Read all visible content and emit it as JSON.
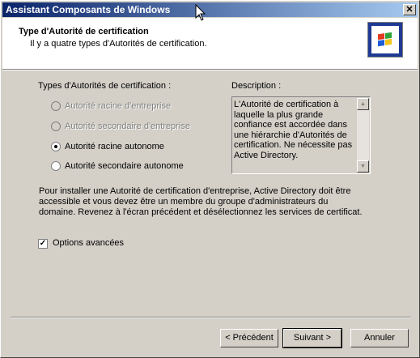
{
  "window": {
    "title": "Assistant Composants de Windows",
    "close_label": "✕"
  },
  "header": {
    "title": "Type d'Autorité de certification",
    "subtitle": "Il y a quatre types d'Autorités de certification."
  },
  "ca_types": {
    "label": "Types d'Autorités de certification :",
    "options": [
      {
        "label": "Autorité racine d'entreprise",
        "enabled": false,
        "checked": false
      },
      {
        "label": "Autorité secondaire d'entreprise",
        "enabled": false,
        "checked": false
      },
      {
        "label": "Autorité racine autonome",
        "enabled": true,
        "checked": true
      },
      {
        "label": "Autorité secondaire autonome",
        "enabled": true,
        "checked": false
      }
    ]
  },
  "description": {
    "label": "Description :",
    "text": "L'Autorité de certification à laquelle la plus grande confiance est accordée dans une hiérarchie d'Autorités de certification. Ne nécessite pas Active Directory."
  },
  "info_text": "Pour installer une Autorité de certification d'entreprise, Active Directory doit être accessible et vous devez être un membre du groupe d'administrateurs du domaine. Revenez à l'écran précédent et désélectionnez les services de certificat.",
  "advanced_options": {
    "label": "Options avancées",
    "checked": true
  },
  "buttons": {
    "back": "< Précédent",
    "next": "Suivant >",
    "cancel": "Annuler"
  }
}
